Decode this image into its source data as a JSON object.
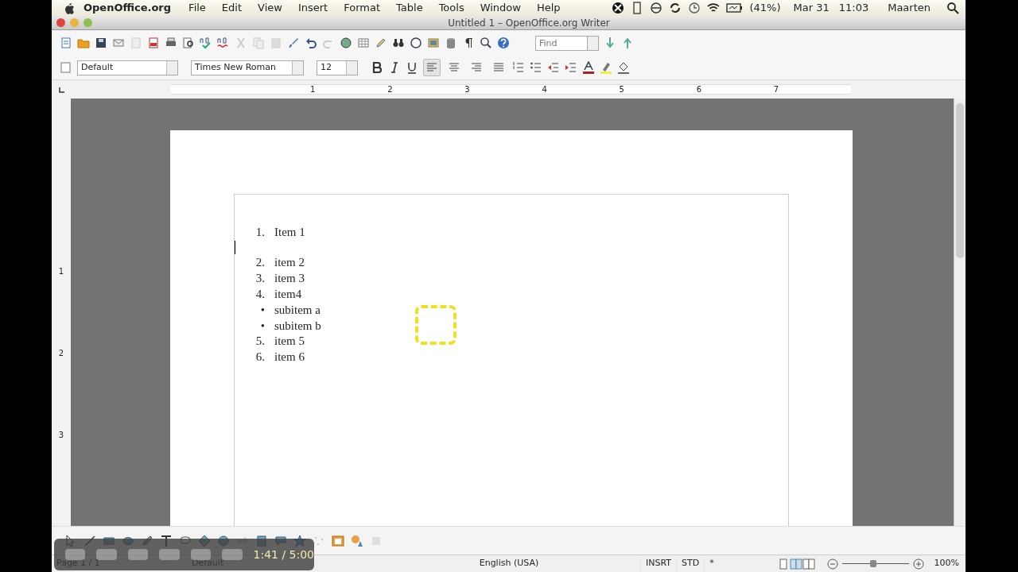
{
  "menubar": {
    "app": "OpenOffice.org",
    "menus": [
      "File",
      "Edit",
      "View",
      "Insert",
      "Format",
      "Table",
      "Tools",
      "Window",
      "Help"
    ],
    "battery": "(41%)",
    "date": "Mar 31",
    "time": "11:03",
    "user": "Maarten"
  },
  "window": {
    "title": "Untitled 1 – OpenOffice.org Writer"
  },
  "find": {
    "placeholder": "Find"
  },
  "formatting": {
    "style": "Default",
    "font": "Times New Roman",
    "size": "12",
    "align_buttons": [
      {
        "kind": "left",
        "selected": true
      },
      {
        "kind": "center",
        "selected": false
      },
      {
        "kind": "right",
        "selected": false
      },
      {
        "kind": "justify",
        "selected": false
      }
    ]
  },
  "ruler": {
    "numbers": [
      "1",
      "2",
      "3",
      "4",
      "5",
      "6",
      "7"
    ]
  },
  "vertical_ruler": {
    "numbers": [
      "1",
      "2",
      "3"
    ]
  },
  "document": {
    "items": [
      {
        "kind": "numbered",
        "marker": "1.",
        "text": "Item 1"
      },
      {
        "kind": "blank",
        "cursor": true
      },
      {
        "kind": "numbered",
        "marker": "2.",
        "text": "item 2"
      },
      {
        "kind": "numbered",
        "marker": "3.",
        "text": "item 3"
      },
      {
        "kind": "numbered",
        "marker": "4.",
        "text": "item4"
      },
      {
        "kind": "bullet",
        "marker": "•",
        "text": "subitem a"
      },
      {
        "kind": "bullet",
        "marker": "•",
        "text": "subitem b"
      },
      {
        "kind": "numbered",
        "marker": "5.",
        "text": "item 5"
      },
      {
        "kind": "numbered",
        "marker": "6.",
        "text": "item 6"
      }
    ]
  },
  "player": {
    "time": "1:41 / 5:00"
  },
  "status_bar": {
    "page": "Page 1 / 1",
    "style": "Default",
    "language": "English (USA)",
    "mode": "INSRT",
    "selection": "STD",
    "modified": "*",
    "zoom": "100%",
    "zoom_level": {
      "level": 0.47
    }
  }
}
